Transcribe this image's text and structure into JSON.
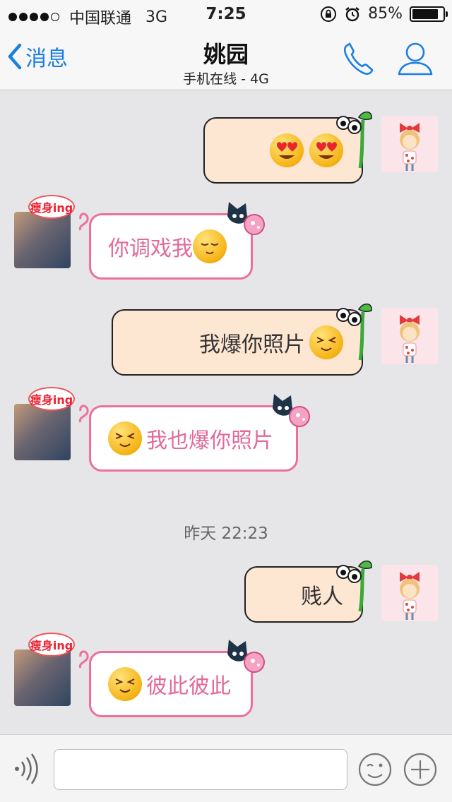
{
  "status_bar": {
    "carrier": "中国联通",
    "network": "3G",
    "time": "7:25",
    "battery": "85%",
    "battery_level": 0.85
  },
  "nav": {
    "back_label": "消息",
    "title": "姚园",
    "subtitle": "手机在线 - 4G"
  },
  "badge_text": "瘦身ing",
  "messages": [
    {
      "sender": "me",
      "text": "",
      "emoji": [
        "heart-eyes",
        "heart-eyes"
      ]
    },
    {
      "sender": "her",
      "text": "你调戏我",
      "emoji": [
        "shy-face"
      ]
    },
    {
      "sender": "me",
      "text": "我爆你照片",
      "emoji": [
        "squint-face"
      ]
    },
    {
      "sender": "her",
      "text": "我也爆你照片",
      "emoji": [
        "squint-face"
      ]
    },
    {
      "sender": "me",
      "text": "贱人",
      "emoji": []
    },
    {
      "sender": "her",
      "text": "彼此彼此",
      "emoji": [
        "squint-face"
      ]
    }
  ],
  "timestamp": "昨天 22:23",
  "input_bar": {
    "value": "",
    "placeholder": ""
  },
  "colors": {
    "accent": "#1a7fe0",
    "her_bubble_border": "#ee6f9c",
    "her_text": "#e26a9a",
    "me_bubble_bg": "#fde6d2"
  }
}
